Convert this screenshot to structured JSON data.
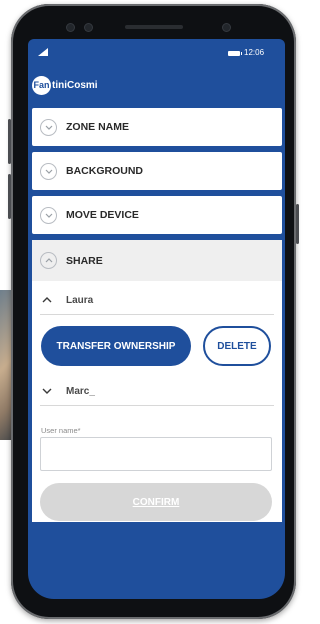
{
  "status_bar": {
    "time": "12:06"
  },
  "app": {
    "logo_badge": "Fan",
    "logo_text": "tiniCosmi"
  },
  "sections": [
    {
      "label": "ZONE NAME"
    },
    {
      "label": "BACKGROUND"
    },
    {
      "label": "MOVE DEVICE"
    }
  ],
  "share": {
    "title": "SHARE",
    "users": [
      {
        "name": "Laura"
      },
      {
        "name": "Marc_"
      }
    ],
    "transfer_button": "TRANSFER OWNERSHIP",
    "delete_button": "DELETE",
    "username_label": "User name*",
    "username_value": "",
    "confirm_button": "CONFIRM"
  },
  "colors": {
    "brand_blue": "#1f4f9c",
    "disabled_grey": "#d7d7d7"
  }
}
